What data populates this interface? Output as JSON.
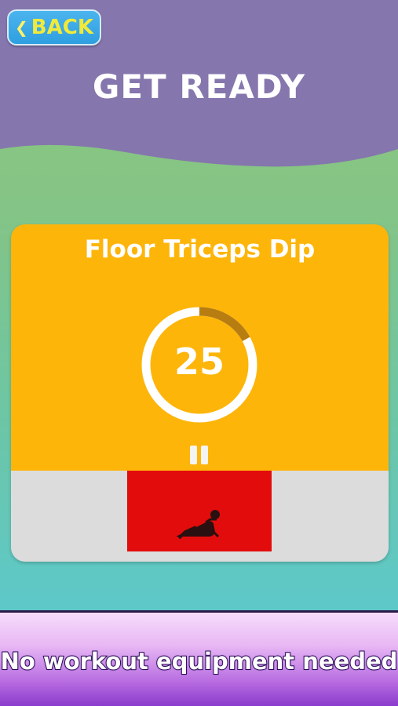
{
  "header": {
    "back_label": "BACK",
    "title": "GET READY",
    "color": "#8576ad"
  },
  "exercise": {
    "name": "Floor Triceps Dip",
    "countdown": "25",
    "countdown_progress_fraction": 0.17,
    "card_color": "#fdb50a",
    "ring_track_color": "#ffffff",
    "ring_progress_color": "#b87d10"
  },
  "controls": {
    "pause_icon": "pause-icon"
  },
  "illustration": {
    "icon": "person-exercise-icon",
    "background": "#e30c0c"
  },
  "banner": {
    "text": "No workout equipment needed"
  }
}
